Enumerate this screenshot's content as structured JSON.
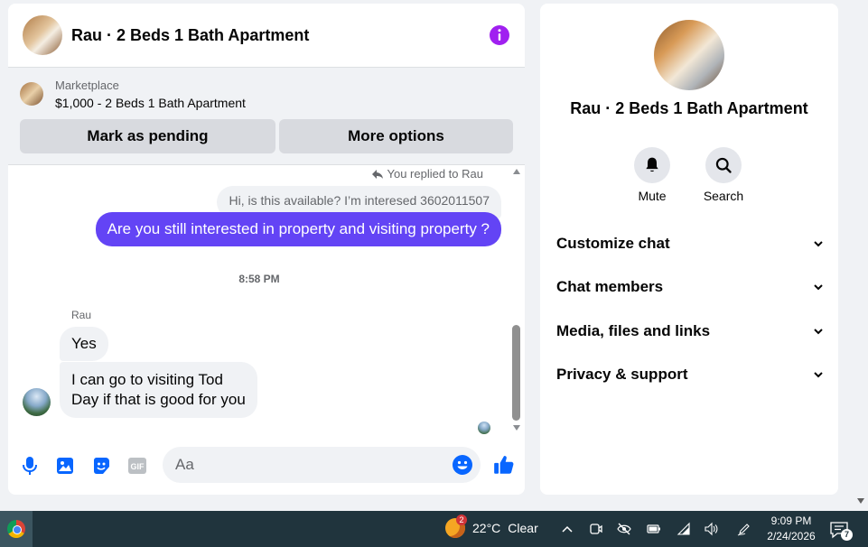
{
  "chat": {
    "title": "Rau · 2 Beds 1 Bath Apartment",
    "marketplace": {
      "source": "Marketplace",
      "item": "$1,000 - 2 Beds 1 Bath Apartment",
      "pending_label": "Mark as pending",
      "options_label": "More options"
    },
    "messages": {
      "replied_note": "You replied to Rau",
      "quoted": "Hi, is this available? I’m interesed 3602011507",
      "outgoing": "Are you still interested in property and visiting property ?",
      "timestamp": "8:58 PM",
      "sender_name": "Rau",
      "incoming_1": "Yes",
      "incoming_2_line1": "I can go to visiting Tod",
      "incoming_2_line2": "Day if that is good for you"
    },
    "composer": {
      "placeholder": "Aa",
      "value": "",
      "icons": [
        "microphone-icon",
        "image-icon",
        "sticker-icon",
        "gif-icon",
        "emoji-icon",
        "thumbs-up-icon"
      ]
    },
    "accent_color": "#6344f5"
  },
  "sidebar": {
    "title": "Rau · 2 Beds 1 Bath Apartment",
    "actions": [
      {
        "label": "Mute",
        "icon": "bell-icon"
      },
      {
        "label": "Search",
        "icon": "search-icon"
      }
    ],
    "sections": [
      {
        "label": "Customize chat"
      },
      {
        "label": "Chat members"
      },
      {
        "label": "Media, files and links"
      },
      {
        "label": "Privacy & support"
      }
    ]
  },
  "taskbar": {
    "weather_temp": "22°C",
    "weather_desc": "Clear",
    "weather_badge": "2",
    "time": "9:09 PM",
    "date": "2/24/2026",
    "notification_count": "7"
  }
}
